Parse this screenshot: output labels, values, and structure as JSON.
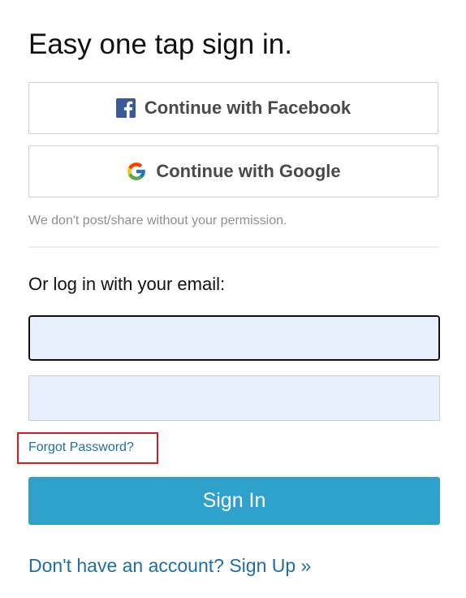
{
  "header": {
    "title": "Easy one tap sign in."
  },
  "social": {
    "facebook_label": "Continue with Facebook",
    "facebook_icon": "facebook-icon",
    "google_label": "Continue with Google",
    "google_icon": "google-icon",
    "note": "We don't post/share without your permission."
  },
  "email_login": {
    "heading": "Or log in with your email:",
    "email_value": "",
    "password_value": "",
    "forgot_label": "Forgot Password?",
    "signin_label": "Sign In",
    "signup_label": "Don't have an account? Sign Up »"
  },
  "colors": {
    "facebook_blue": "#3b5998",
    "signin_button": "#2fa2cb",
    "link": "#1f6fa3",
    "input_autofill": "#e8f0fe",
    "highlight_box": "#d21f1f"
  }
}
